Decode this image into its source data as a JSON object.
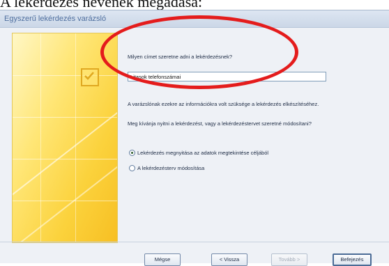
{
  "document": {
    "caption": "A lekérdezés nevének megadása:"
  },
  "dialog": {
    "title": "Egyszerű lekérdezés varázsló",
    "question": "Milyen címet szeretne adni a lekérdezésnek?",
    "query_name_value": "Litasok telefonszámai",
    "info_text": "A varázslónak ezekre az információkra volt szüksége a lekérdezés elkészítéséhez.",
    "prompt_text": "Meg kívánja nyitni a lekérdezést, vagy a lekérdezéstervet szeretné módosítani?",
    "options": [
      {
        "label": "Lekérdezés megnyitása az adatok megtekintése céljából",
        "checked": true
      },
      {
        "label": "A lekérdezésterv módosítása",
        "checked": false
      }
    ],
    "buttons": {
      "cancel": "Mégse",
      "back": "< Vissza",
      "next": "Tovább >",
      "finish": "Befejezés"
    }
  },
  "colors": {
    "annotation": "#e41c1c",
    "wizard_image": "#fbd23c"
  },
  "icons": {
    "wizard_image": "checkmark-icon"
  }
}
